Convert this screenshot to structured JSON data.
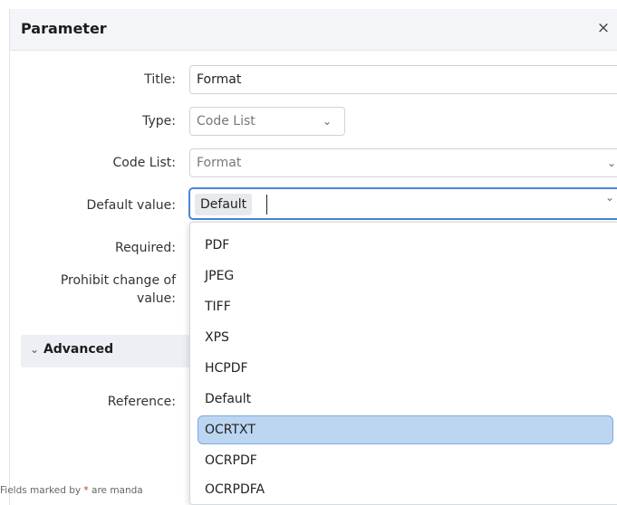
{
  "dialog": {
    "title": "Parameter",
    "close": "×"
  },
  "form": {
    "title_label": "Title:",
    "title_value": "Format",
    "type_label": "Type:",
    "type_value": "Code List",
    "code_list_label": "Code List:",
    "code_list_value": "Format",
    "default_label": "Default value:",
    "default_chip": "Default",
    "required_label": "Required:",
    "prohibit_label_line1": "Prohibit change of",
    "prohibit_label_line2": "value:",
    "advanced_label": "Advanced",
    "reference_label": "Reference:"
  },
  "footer": {
    "text_before": "Fields marked by ",
    "star": "*",
    "text_after": " are manda"
  },
  "dropdown": {
    "options": [
      "PDF",
      "JPEG",
      "TIFF",
      "XPS",
      "HCPDF",
      "Default",
      "OCRTXT",
      "OCRPDF",
      "OCRPDFA"
    ],
    "highlighted": "OCRTXT"
  },
  "icons": {
    "close": "close-icon",
    "chevron": "chevron-down-icon"
  },
  "colors": {
    "accent": "#4a86d8",
    "highlight": "#bcd6f2",
    "header_bg": "#f3f5f9"
  }
}
